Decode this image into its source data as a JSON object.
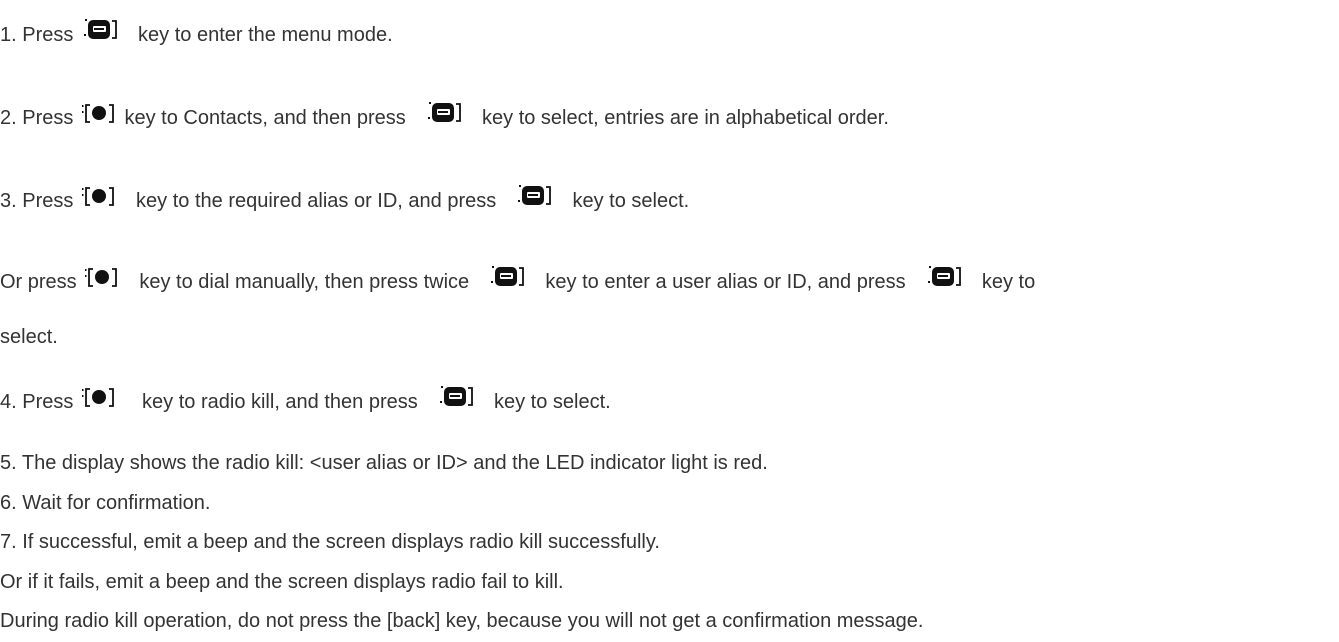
{
  "steps": {
    "s1": {
      "a": "1. Press",
      "b": "key to enter the menu mode."
    },
    "s2": {
      "a": "2. Press",
      "b": "key to Contacts, and then press",
      "c": "key to select, entries are in alphabetical order."
    },
    "s3": {
      "a": "3. Press",
      "b": "key to the required alias or ID, and press",
      "c": "key to select."
    },
    "s3b": {
      "a": "Or press",
      "b": "key to dial manually, then press twice",
      "c": "key to enter a user alias or ID, and press",
      "d": "key to",
      "e": "select."
    },
    "s4": {
      "a": "4. Press",
      "b": "key to radio kill, and then press",
      "c": "key to select."
    },
    "s5": "5. The display shows the radio kill: <user alias or ID> and the LED indicator light is red.",
    "s6": "6. Wait for confirmation.",
    "s7": "7. If successful, emit a beep and the screen displays radio kill successfully.",
    "s7b": "Or if it fails, emit a beep and the screen displays radio fail to kill.",
    "note": "During radio kill operation, do not press the [back] key, because you will not get a confirmation message."
  },
  "icons": {
    "menu_key": "menu-key-icon",
    "nav_key": "nav-key-icon",
    "color": "#111111"
  }
}
